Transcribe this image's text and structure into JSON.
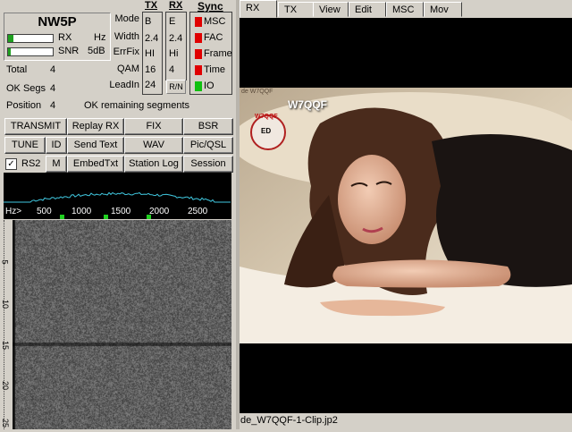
{
  "station": {
    "callsign": "NW5P",
    "rx_label": "RX",
    "rx_unit": "Hz",
    "snr_label": "SNR",
    "snr_value": "5dB",
    "rx_level": 0.12,
    "snr_level": 0.05
  },
  "stats": {
    "total_label": "Total",
    "total_value": "4",
    "ok_segs_label": "OK Segs",
    "ok_segs_value": "4",
    "position_label": "Position",
    "position_value": "4",
    "remaining_text": "OK remaining segments"
  },
  "params": {
    "tx_header": "TX",
    "rx_header": "RX",
    "rows": [
      {
        "label": "Mode",
        "tx": "B",
        "rx": "E"
      },
      {
        "label": "Width",
        "tx": "2.4",
        "rx": "2.4"
      },
      {
        "label": "ErrFix",
        "tx": "HI",
        "rx": "Hi"
      },
      {
        "label": "QAM",
        "tx": "16",
        "rx": "4"
      },
      {
        "label": "LeadIn",
        "tx": "24",
        "rx": "R/N"
      }
    ]
  },
  "sync": {
    "header": "Sync",
    "items": [
      {
        "label": "MSC",
        "color": "#e00000"
      },
      {
        "label": "FAC",
        "color": "#e00000"
      },
      {
        "label": "Frame",
        "color": "#e00000"
      },
      {
        "label": "Time",
        "color": "#e00000"
      },
      {
        "label": "IO",
        "color": "#10c010"
      }
    ]
  },
  "buttons": {
    "transmit": "TRANSMIT",
    "replay_rx": "Replay RX",
    "fix": "FIX",
    "bsr": "BSR",
    "tune": "TUNE",
    "id": "ID",
    "send_text": "Send Text",
    "wav": "WAV",
    "pic_qsl": "Pic/QSL",
    "rs2": "RS2",
    "m": "M",
    "embed_txt": "EmbedTxt",
    "station_log": "Station Log",
    "session": "Session"
  },
  "spectrum": {
    "scale_prefix": "Hz>",
    "ticks": [
      "500",
      "1000",
      "1500",
      "2000",
      "2500"
    ]
  },
  "waterfall": {
    "time_ticks": [
      "5",
      "10",
      "15",
      "20",
      "25"
    ]
  },
  "tabs": [
    "RX",
    "TX",
    "View",
    "Edit",
    "MSC",
    "Mov"
  ],
  "image": {
    "overlay_call": "W7QQF",
    "overlay_small": "de W7QQF",
    "stamp_text": "W7QQF",
    "stamp_center": "ED"
  },
  "status": {
    "filename": "de_W7QQF-1-Clip.jp2"
  }
}
